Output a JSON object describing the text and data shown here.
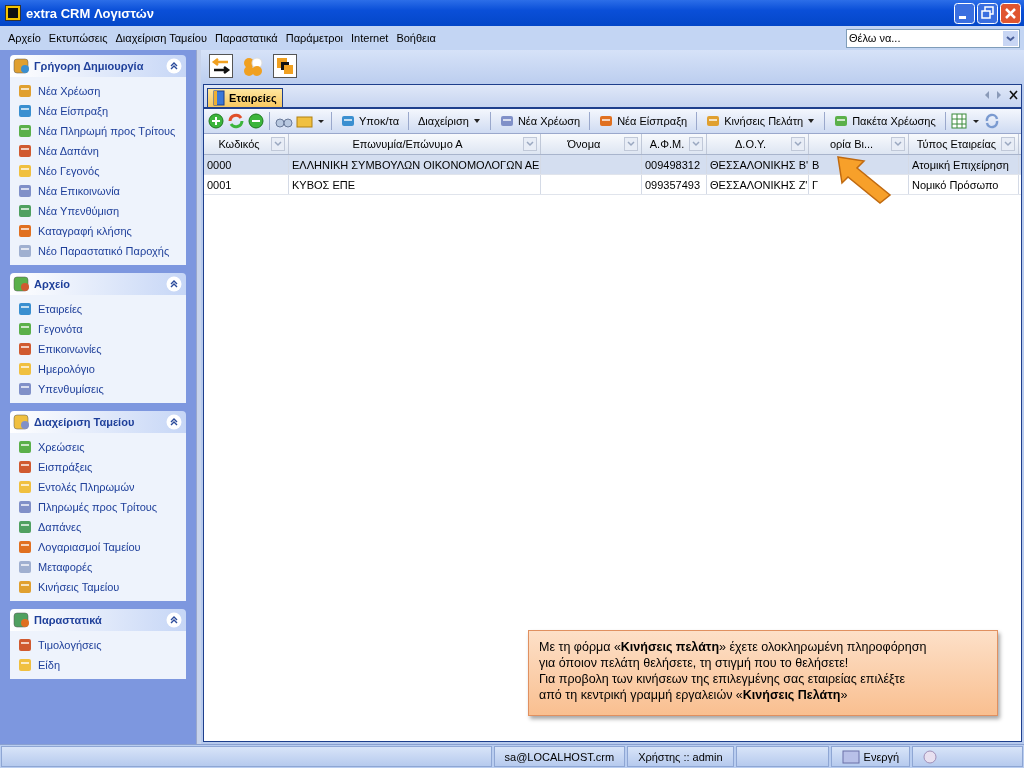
{
  "window": {
    "title": "extra CRM Λογιστών"
  },
  "menu": [
    "Αρχείο",
    "Εκτυπώσεις",
    "Διαχείριση Ταμείου",
    "Παραστατικά",
    "Παράμετροι",
    "Internet",
    "Βοήθεια"
  ],
  "quick_search": {
    "value": "Θέλω να..."
  },
  "sidebar": [
    {
      "title": "Γρήγορη Δημιουργία",
      "expanded": true,
      "items": [
        "Νέα Χρέωση",
        "Νέα Είσπραξη",
        "Νέα Πληρωμή προς Τρίτους",
        "Νέα Δαπάνη",
        "Νέο Γεγονός",
        "Νέα Επικοινωνία",
        "Νέα Υπενθύμιση",
        "Καταγραφή κλήσης",
        "Νέο Παραστατικό Παροχής"
      ]
    },
    {
      "title": "Αρχείο",
      "expanded": true,
      "items": [
        "Εταιρείες",
        "Γεγονότα",
        "Επικοινωνίες",
        "Ημερολόγιο",
        "Υπενθυμίσεις"
      ]
    },
    {
      "title": "Διαχείριση Ταμείου",
      "expanded": true,
      "items": [
        "Χρεώσεις",
        "Εισπράξεις",
        "Εντολές Πληρωμών",
        "Πληρωμές προς Τρίτους",
        "Δαπάνες",
        "Λογαριασμοί Ταμείου",
        "Μεταφορές",
        "Κινήσεις Ταμείου"
      ]
    },
    {
      "title": "Παραστατικά",
      "expanded": true,
      "items": [
        "Τιμολογήσεις",
        "Είδη"
      ]
    }
  ],
  "tabs": [
    {
      "label": "Εταιρείες",
      "selected": true
    }
  ],
  "toolbar_buttons": [
    {
      "label": "Υποκ/τα",
      "has_menu": false
    },
    {
      "label": "Διαχείριση",
      "has_menu": true
    },
    {
      "label": "Νέα Χρέωση",
      "has_menu": false
    },
    {
      "label": "Νέα Είσπραξη",
      "has_menu": false
    },
    {
      "label": "Κινήσεις Πελάτη",
      "has_menu": true
    },
    {
      "label": "Πακέτα Χρέωσης",
      "has_menu": false
    }
  ],
  "table": {
    "columns": [
      "Κωδικός",
      "Επωνυμία/Επώνυμο Α",
      "Όνομα",
      "Α.Φ.Μ.",
      "Δ.Ο.Υ.",
      "ορία Βι...",
      "Τύπος Εταιρείας"
    ],
    "rows": [
      {
        "selected": true,
        "cells": [
          "0000",
          "ΕΛΛΗΝΙΚΗ ΣΥΜΒΟΥΛΩΝ ΟΙΚΟΝΟΜΟΛΟΓΩΝ ΑΕ",
          "",
          "009498312",
          "ΘΕΣΣΑΛΟΝΙΚΗΣ Β'",
          "Β",
          "Ατομική Επιχείρηση"
        ]
      },
      {
        "selected": false,
        "cells": [
          "0001",
          "ΚΥΒΟΣ ΕΠΕ",
          "",
          "099357493",
          "ΘΕΣΣΑΛΟΝΙΚΗΣ Ζ'",
          "Γ",
          "Νομικό Πρόσωπο"
        ]
      }
    ]
  },
  "callout": {
    "text": "Με τη φόρμα «**Κινήσεις πελάτη**» έχετε ολοκληρωμένη πληροφόρηση\nγια όποιον πελάτη θελήσετε, τη στιγμή που το θελήσετε!\nΓια προβολη των κινήσεων της επιλεγμένης σας εταιρείας επιλέξτε\nαπό τη κεντρική γραμμή εργαλειών «**Κινήσεις Πελάτη**»"
  },
  "status_bar": [
    "sa@LOCALHOST.crm",
    "Χρήστης :: admin",
    "Ενεργή"
  ]
}
